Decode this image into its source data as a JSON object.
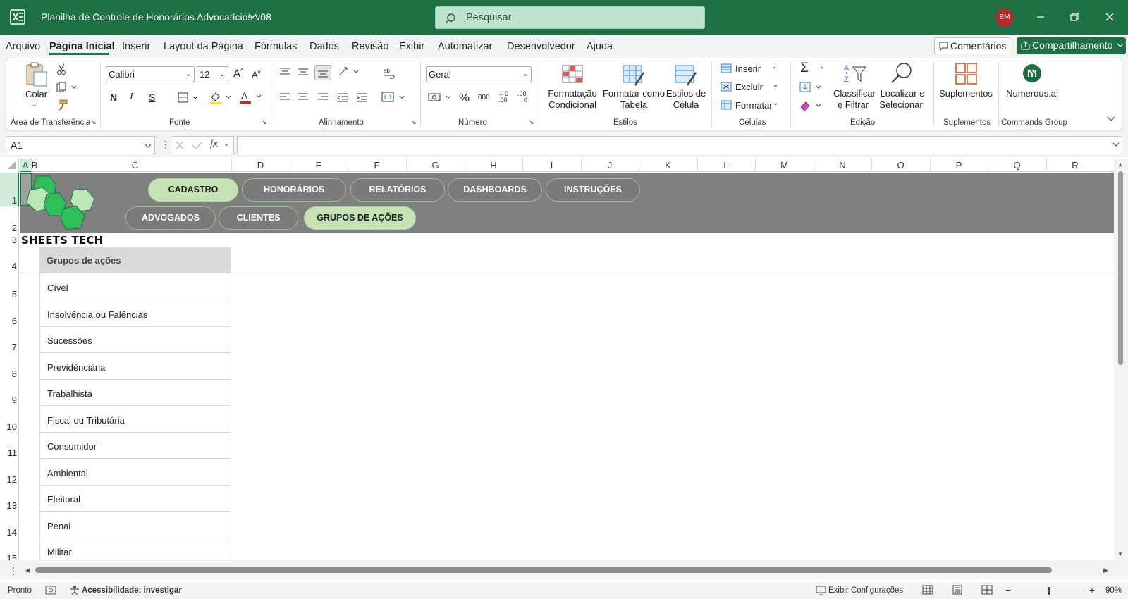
{
  "window": {
    "title": "Planilha de Controle de Honorários Advocatícios v08",
    "search_placeholder": "Pesquisar",
    "user_initials": "BM"
  },
  "menu": {
    "items": [
      "Arquivo",
      "Página Inicial",
      "Inserir",
      "Layout da Página",
      "Fórmulas",
      "Dados",
      "Revisão",
      "Exibir",
      "Automatizar",
      "Desenvolvedor",
      "Ajuda"
    ],
    "active": "Página Inicial",
    "comments_label": "Comentários",
    "share_label": "Compartilhamento"
  },
  "ribbon": {
    "clipboard": {
      "paste_label": "Colar",
      "group_label": "Área de Transferência"
    },
    "font": {
      "family": "Calibri",
      "size": "12",
      "bold": "N",
      "italic": "I",
      "underline": "S",
      "group_label": "Fonte"
    },
    "alignment": {
      "group_label": "Alinhamento"
    },
    "number": {
      "format": "Geral",
      "group_label": "Número"
    },
    "styles": {
      "conditional_l1": "Formatação",
      "conditional_l2": "Condicional",
      "table_l1": "Formatar como",
      "table_l2": "Tabela",
      "cell_l1": "Estilos de",
      "cell_l2": "Célula",
      "group_label": "Estilos"
    },
    "cells": {
      "insert": "Inserir",
      "delete": "Excluir",
      "format": "Formatar",
      "group_label": "Células"
    },
    "editing": {
      "sort_l1": "Classificar",
      "sort_l2": "e Filtrar",
      "find_l1": "Localizar e",
      "find_l2": "Selecionar",
      "group_label": "Edição"
    },
    "addins": {
      "label": "Suplementos",
      "group_label": "Suplementos"
    },
    "numerous": {
      "label": "Numerous.ai",
      "group_label": "Commands Group"
    }
  },
  "formula_bar": {
    "name_box": "A1",
    "fx": "fx",
    "value": ""
  },
  "columns": [
    "A",
    "B",
    "C",
    "D",
    "E",
    "F",
    "G",
    "H",
    "I",
    "J",
    "K",
    "L",
    "M",
    "N",
    "O",
    "P",
    "Q",
    "R"
  ],
  "rows": [
    "1",
    "2",
    "3",
    "4",
    "5",
    "6",
    "7",
    "8",
    "9",
    "10",
    "11",
    "12",
    "13",
    "14",
    "15"
  ],
  "sheet": {
    "brand": "SHEETS TECH",
    "nav_top": [
      "CADASTRO",
      "HONORÁRIOS",
      "RELATÓRIOS",
      "DASHBOARDS",
      "INSTRUÇÕES"
    ],
    "nav_bottom": [
      "ADVOGADOS",
      "CLIENTES",
      "GRUPOS DE AÇÕES"
    ],
    "active_top": "CADASTRO",
    "active_bottom": "GRUPOS DE AÇÕES",
    "table_header": "Grupos de ações",
    "table_rows": [
      "Cível",
      "Insolvência ou Falências",
      "Sucessões",
      "Previdênciária",
      "Trabalhista",
      "Fiscal ou Tributária",
      "Consumidor",
      "Ambiental",
      "Eleitoral",
      "Penal",
      "Militar"
    ]
  },
  "status": {
    "ready": "Pronto",
    "accessibility": "Acessibilidade: investigar",
    "display_settings": "Exibir Configurações",
    "zoom": "90%"
  },
  "colors": {
    "excel_green": "#1e7145",
    "banner_gray": "#808080",
    "pill_active": "#c6e3b5",
    "logo_green": "#2fbf5a"
  }
}
